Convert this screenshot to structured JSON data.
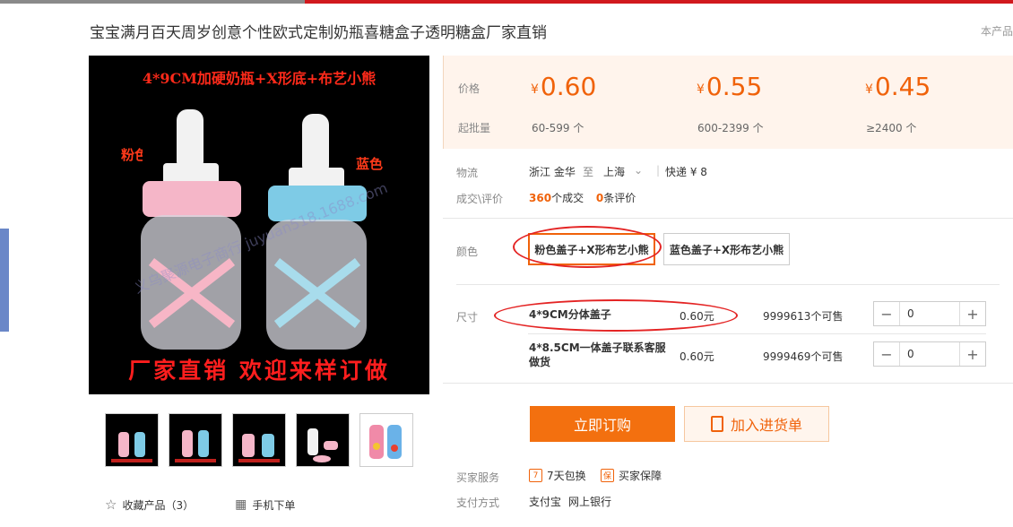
{
  "title": "宝宝满月百天周岁创意个性欧式定制奶瓶喜糖盒子透明糖盒厂家直销",
  "side_note": "本产品",
  "image": {
    "top_text": "4*9CM加硬奶瓶+X形底+布艺小熊",
    "label_pink": "粉色",
    "label_blue": "蓝色",
    "watermark": "义乌聚源电子商行 juyuan518.1688.com",
    "bottom_text": "厂家直销 欢迎来样订做"
  },
  "thumbnails": [
    "thumb-1",
    "thumb-2",
    "thumb-3",
    "thumb-4",
    "thumb-5"
  ],
  "tools": {
    "favorite": "收藏产品（3）",
    "mobile": "手机下单"
  },
  "price": {
    "price_label": "价格",
    "moq_label": "起批量",
    "tiers": [
      {
        "currency": "¥",
        "value": "0.60",
        "range": "60-599 个"
      },
      {
        "currency": "¥",
        "value": "0.55",
        "range": "600-2399 个"
      },
      {
        "currency": "¥",
        "value": "0.45",
        "range": "≥2400 个"
      }
    ]
  },
  "logistics": {
    "label": "物流",
    "from": "浙江 金华",
    "to_word": "至",
    "to": "上海",
    "express": "快递 ¥ 8"
  },
  "deals": {
    "label": "成交\\评价",
    "deal_count": "360",
    "deal_text": "个成交",
    "review_count": "0",
    "review_text": "条评价"
  },
  "color": {
    "label": "颜色",
    "options": [
      "粉色盖子+X形布艺小熊",
      "蓝色盖子+X形布艺小熊"
    ],
    "selected": 0
  },
  "size": {
    "label": "尺寸",
    "rows": [
      {
        "name": "4*9CM分体盖子",
        "price": "0.60元",
        "stock": "9999613个可售",
        "qty": "0"
      },
      {
        "name": "4*8.5CM一体盖子联系客服做货",
        "price": "0.60元",
        "stock": "9999469个可售",
        "qty": "0"
      }
    ]
  },
  "actions": {
    "buy": "立即订购",
    "cart": "加入进货单"
  },
  "service": {
    "label": "买家服务",
    "items": [
      {
        "icon": "7",
        "text": "7天包换"
      },
      {
        "icon": "保",
        "text": "买家保障"
      }
    ]
  },
  "payment": {
    "label": "支付方式",
    "methods": [
      "支付宝",
      "网上银行"
    ]
  },
  "colors": {
    "accent": "#f0620a",
    "highlight_oval": "#e42424",
    "price_bg": "#fff4ec"
  }
}
